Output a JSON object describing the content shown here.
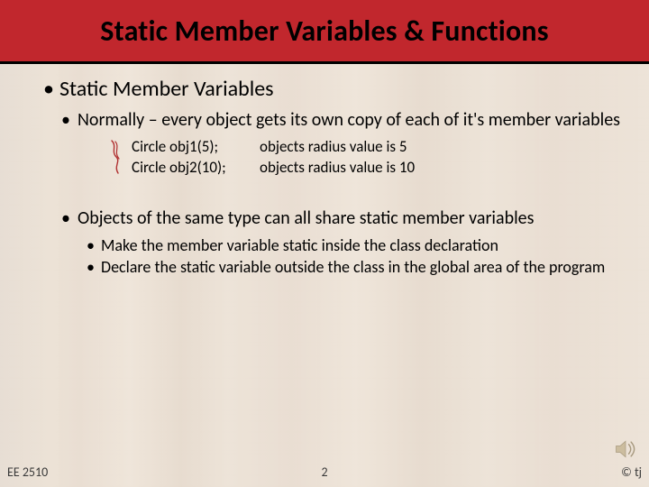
{
  "title": "Static Member Variables & Functions",
  "bullets": {
    "l1": "Static Member Variables",
    "l2a": "Normally – every object gets its own copy of each of it's member variables",
    "code": {
      "r1c1": "Circle obj1(5);",
      "r1c2": "objects radius value is 5",
      "r2c1": "Circle obj2(10);",
      "r2c2": "objects radius value is 10"
    },
    "l2b": "Objects of the same type can all share static member variables",
    "l3a": "Make the member variable static inside the class declaration",
    "l3b": "Declare the static variable outside the class in the global area of the program"
  },
  "footer": {
    "left": "EE 2510",
    "center": "2",
    "right": "© tj"
  }
}
